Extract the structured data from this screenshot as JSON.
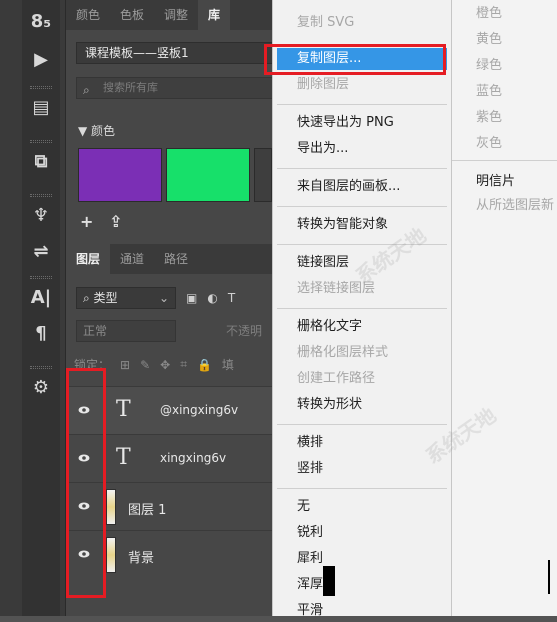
{
  "tools": [
    {
      "name": "grid-tool-icon",
      "glyph": "8̣5"
    },
    {
      "name": "play-icon",
      "glyph": "▶"
    },
    {
      "name": "library-stack-icon",
      "glyph": "▤"
    },
    {
      "name": "brush-settings-icon",
      "glyph": "⧉"
    },
    {
      "name": "clone-stamp-icon",
      "glyph": "♆"
    },
    {
      "name": "sliders-icon",
      "glyph": "⇌"
    },
    {
      "name": "character-icon",
      "glyph": "A|"
    },
    {
      "name": "paragraph-icon",
      "glyph": "¶"
    },
    {
      "name": "3d-icon",
      "glyph": "⚙"
    }
  ],
  "top_tabs": [
    "颜色",
    "色板",
    "调整",
    "库"
  ],
  "library": {
    "selected": "课程模板——竖板1",
    "search_placeholder": "搜索所有库",
    "color_header": "▼ 颜色",
    "swatches": [
      "#7b2fb5",
      "#17e06a",
      "#3e3e3e"
    ],
    "add_glyph": "+",
    "upload_glyph": "⇪"
  },
  "layer_tabs": [
    "图层",
    "通道",
    "路径"
  ],
  "filter": {
    "kind_label": "类型",
    "chevron": "⌄",
    "icons": [
      "▣",
      "◐",
      "T"
    ]
  },
  "blend": {
    "mode": "正常",
    "opacity_label": "不透明"
  },
  "lock": {
    "label": "锁定：",
    "icons": [
      "⊞",
      "✎",
      "✥",
      "⌗",
      "🔒",
      "填"
    ]
  },
  "layers": [
    {
      "type": "text",
      "name": "@xingxing6v",
      "glyph": "T"
    },
    {
      "type": "text",
      "name": "xingxing6v",
      "glyph": "T"
    },
    {
      "type": "image",
      "name": "图层 1"
    },
    {
      "type": "image",
      "name": "背景"
    }
  ],
  "menu": [
    {
      "label": "复制 SVG",
      "disabled": true
    },
    {
      "label": "复制图层...",
      "highlight": true
    },
    {
      "label": "删除图层",
      "disabled": true
    },
    {
      "label": "快速导出为 PNG"
    },
    {
      "label": "导出为..."
    },
    {
      "label": "来自图层的画板..."
    },
    {
      "label": "转换为智能对象"
    },
    {
      "label": "链接图层"
    },
    {
      "label": "选择链接图层",
      "disabled": true
    },
    {
      "label": "栅格化文字"
    },
    {
      "label": "栅格化图层样式",
      "disabled": true
    },
    {
      "label": "创建工作路径",
      "disabled": true
    },
    {
      "label": "转换为形状"
    },
    {
      "label": "横排"
    },
    {
      "label": "竖排"
    },
    {
      "label": "无"
    },
    {
      "label": "锐利"
    },
    {
      "label": "犀利"
    },
    {
      "label": "浑厚"
    },
    {
      "label": "平滑"
    }
  ],
  "submenu": [
    {
      "label": "橙色",
      "disabled": true
    },
    {
      "label": "黄色",
      "disabled": true
    },
    {
      "label": "绿色",
      "disabled": true
    },
    {
      "label": "蓝色",
      "disabled": true
    },
    {
      "label": "紫色",
      "disabled": true
    },
    {
      "label": "灰色",
      "disabled": true
    },
    {
      "label": "明信片"
    },
    {
      "label": "从所选图层新",
      "disabled": true
    }
  ],
  "watermark": "系统天地"
}
